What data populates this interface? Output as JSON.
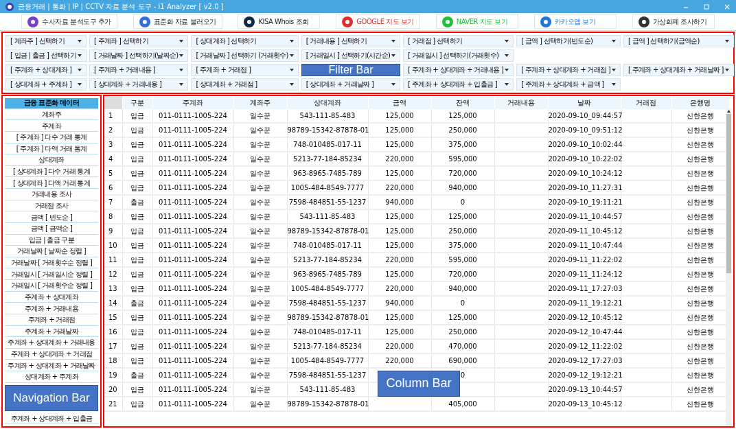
{
  "window": {
    "title": "금융거래 | 통화 | IP | CCTV 자료 분석 도구 - i1 Analyzer [ v2.0 ]"
  },
  "toolbar": [
    {
      "label": "수사자료 분석도구 추가",
      "color": "#7a3fc8"
    },
    {
      "label": "표준화 자료 불러오기",
      "color": "#2f6fe0"
    },
    {
      "label": "KISA Whois 조회",
      "color": "#0e2a4a"
    },
    {
      "label": "GOOGLE 지도 보기",
      "color": "#e0312f"
    },
    {
      "label": "NAVER 지도 보기",
      "color": "#1fbf3a"
    },
    {
      "label": "카카오맵 보기",
      "color": "#1f78d8"
    },
    {
      "label": "가상화폐 조사하기",
      "color": "#333333"
    }
  ],
  "filter_bar": {
    "annotation": "Filter Bar",
    "rows": [
      [
        "[ 계좌주 ] 선택하기",
        "[ 주계좌 ] 선택하기",
        "[ 상대계좌 ] 선택하기",
        "[ 거래내용 ] 선택하기",
        "[ 거래점 ] 선택하기",
        "[ 금액 ] 선택하기(빈도순)",
        "[ 금액 ] 선택하기(금액순)"
      ],
      [
        "[ 입금 | 출금 ] 선택하기",
        "[ 거래날짜 ] 선택하기(날짜순)",
        "[ 거래날짜 ] 선택하기 (거래횟수)",
        "[ 거래일시 ] 선택하기(시간순)",
        "[ 거래일시 ] 선택하기(거래횟수)"
      ],
      [
        "[ 주계좌 + 상대계좌 ]",
        "[ 주계좌 + 거래내용 ]",
        "[ 주계좌 + 거래점 ]",
        null,
        "[ 주계좌 + 상대계좌 + 거래내용 ]",
        "[ 주계좌 + 상대계좌 + 거래점 ]",
        "[ 주계좌 + 상대계좌 + 거래날짜 ]"
      ],
      [
        "[ 상대계좌 + 주계좌 ]",
        "[ 상대계좌 + 거래내용 ]",
        "[ 상대계좌 + 거래점 ]",
        "[ 상대계좌 + 거래날짜 ]",
        "[ 주계좌 + 상대계좌 + 입출금 ]",
        "[ 주계좌 + 상대계좌 + 금액 ]"
      ]
    ]
  },
  "navigation": {
    "annotation": "Navigation Bar",
    "items": [
      {
        "label": "금융 표준화 데이터",
        "selected": true
      },
      {
        "label": "계좌주",
        "selected": false
      },
      {
        "label": "주계좌",
        "selected": false
      },
      {
        "label": "[ 주계좌 ] 다수 거래 통계",
        "selected": false
      },
      {
        "label": "[ 주계좌 ] 다액 거래 통계",
        "selected": false
      },
      {
        "label": "상대계좌",
        "selected": false
      },
      {
        "label": "[ 상대계좌 ] 다수 거래 통계",
        "selected": false
      },
      {
        "label": "[ 상대계좌 ] 다액 거래 통계",
        "selected": false
      },
      {
        "label": "거래내용 조사",
        "selected": false
      },
      {
        "label": "거래점 조사",
        "selected": false
      },
      {
        "label": "금액 [ 빈도순 ]",
        "selected": false
      },
      {
        "label": "금액 [ 금액순 ]",
        "selected": false
      },
      {
        "label": "입금 | 출금 구분",
        "selected": false
      },
      {
        "label": "거래날짜 [ 날짜순 정렬 ]",
        "selected": false
      },
      {
        "label": "거래날짜 [ 거래횟수순 정렬 ]",
        "selected": false
      },
      {
        "label": "거래일시 [ 거래일시순 정렬 ]",
        "selected": false
      },
      {
        "label": "거래일시 [ 거래횟수순 정렬 ]",
        "selected": false
      },
      {
        "label": "주계좌 + 상대계좌",
        "selected": false
      },
      {
        "label": "주계좌 + 거래내용",
        "selected": false
      },
      {
        "label": "주계좌 + 거래점",
        "selected": false
      },
      {
        "label": "주계좌 + 거래날짜",
        "selected": false
      },
      {
        "label": "주계좌 + 상대계좌 + 거래내용",
        "selected": false
      },
      {
        "label": "주계좌 + 상대계좌 + 거래점",
        "selected": false
      },
      {
        "label": "주계좌 + 상대계좌 + 거래날짜",
        "selected": false
      },
      {
        "label": "상대계좌 + 주계좌",
        "selected": false
      },
      {
        "kind": "annotation"
      },
      {
        "label": "주계좌 + 상대계좌 + 입출금",
        "selected": false
      }
    ]
  },
  "table": {
    "annotation": "Column Bar",
    "columns": [
      "구분",
      "주계좌",
      "계좌주",
      "상대계좌",
      "금액",
      "잔액",
      "거래내용",
      "날짜",
      "거래점",
      "은행명"
    ],
    "rows": [
      {
        "no": "1",
        "type": "입금",
        "account": "011-0111-1005-224",
        "owner": "일수꾼",
        "counterpart": "543-111-85-483",
        "amount": "125,000",
        "balance": "125,000",
        "date": "2020-09-10_09:44:57",
        "bank": "신한은행"
      },
      {
        "no": "2",
        "type": "입금",
        "account": "011-0111-1005-224",
        "owner": "일수꾼",
        "counterpart": "98789-15342-87878-01",
        "amount": "125,000",
        "balance": "250,000",
        "date": "2020-09-10_09:51:12",
        "bank": "신한은행"
      },
      {
        "no": "3",
        "type": "입금",
        "account": "011-0111-1005-224",
        "owner": "일수꾼",
        "counterpart": "748-010485-017-11",
        "amount": "125,000",
        "balance": "375,000",
        "date": "2020-09-10_10:02:44",
        "bank": "신한은행"
      },
      {
        "no": "4",
        "type": "입금",
        "account": "011-0111-1005-224",
        "owner": "일수꾼",
        "counterpart": "5213-77-184-85234",
        "amount": "220,000",
        "balance": "595,000",
        "date": "2020-09-10_10:22:02",
        "bank": "신한은행"
      },
      {
        "no": "5",
        "type": "입금",
        "account": "011-0111-1005-224",
        "owner": "일수꾼",
        "counterpart": "963-8965-7485-789",
        "amount": "125,000",
        "balance": "720,000",
        "date": "2020-09-10_10:24:12",
        "bank": "신한은행"
      },
      {
        "no": "6",
        "type": "입금",
        "account": "011-0111-1005-224",
        "owner": "일수꾼",
        "counterpart": "1005-484-8549-7777",
        "amount": "220,000",
        "balance": "940,000",
        "date": "2020-09-10_11:27:31",
        "bank": "신한은행"
      },
      {
        "no": "7",
        "type": "출금",
        "account": "011-0111-1005-224",
        "owner": "일수꾼",
        "counterpart": "7598-484851-55-1237",
        "amount": "940,000",
        "balance": "0",
        "date": "2020-09-10_19:11:21",
        "bank": "신한은행"
      },
      {
        "no": "8",
        "type": "입금",
        "account": "011-0111-1005-224",
        "owner": "일수꾼",
        "counterpart": "543-111-85-483",
        "amount": "125,000",
        "balance": "125,000",
        "date": "2020-09-11_10:44:57",
        "bank": "신한은행"
      },
      {
        "no": "9",
        "type": "입금",
        "account": "011-0111-1005-224",
        "owner": "일수꾼",
        "counterpart": "98789-15342-87878-01",
        "amount": "125,000",
        "balance": "250,000",
        "date": "2020-09-11_10:45:12",
        "bank": "신한은행"
      },
      {
        "no": "10",
        "type": "입금",
        "account": "011-0111-1005-224",
        "owner": "일수꾼",
        "counterpart": "748-010485-017-11",
        "amount": "125,000",
        "balance": "375,000",
        "date": "2020-09-11_10:47:44",
        "bank": "신한은행"
      },
      {
        "no": "11",
        "type": "입금",
        "account": "011-0111-1005-224",
        "owner": "일수꾼",
        "counterpart": "5213-77-184-85234",
        "amount": "220,000",
        "balance": "595,000",
        "date": "2020-09-11_11:22:02",
        "bank": "신한은행"
      },
      {
        "no": "12",
        "type": "입금",
        "account": "011-0111-1005-224",
        "owner": "일수꾼",
        "counterpart": "963-8965-7485-789",
        "amount": "125,000",
        "balance": "720,000",
        "date": "2020-09-11_11:24:12",
        "bank": "신한은행"
      },
      {
        "no": "13",
        "type": "입금",
        "account": "011-0111-1005-224",
        "owner": "일수꾼",
        "counterpart": "1005-484-8549-7777",
        "amount": "220,000",
        "balance": "940,000",
        "date": "2020-09-11_17:27:03",
        "bank": "신한은행"
      },
      {
        "no": "14",
        "type": "출금",
        "account": "011-0111-1005-224",
        "owner": "일수꾼",
        "counterpart": "7598-484851-55-1237",
        "amount": "940,000",
        "balance": "0",
        "date": "2020-09-11_19:12:21",
        "bank": "신한은행"
      },
      {
        "no": "15",
        "type": "입금",
        "account": "011-0111-1005-224",
        "owner": "일수꾼",
        "counterpart": "98789-15342-87878-01",
        "amount": "125,000",
        "balance": "125,000",
        "date": "2020-09-12_10:45:12",
        "bank": "신한은행"
      },
      {
        "no": "16",
        "type": "입금",
        "account": "011-0111-1005-224",
        "owner": "일수꾼",
        "counterpart": "748-010485-017-11",
        "amount": "125,000",
        "balance": "250,000",
        "date": "2020-09-12_10:47:44",
        "bank": "신한은행"
      },
      {
        "no": "17",
        "type": "입금",
        "account": "011-0111-1005-224",
        "owner": "일수꾼",
        "counterpart": "5213-77-184-85234",
        "amount": "220,000",
        "balance": "470,000",
        "date": "2020-09-12_11:22:02",
        "bank": "신한은행"
      },
      {
        "no": "18",
        "type": "입금",
        "account": "011-0111-1005-224",
        "owner": "일수꾼",
        "counterpart": "1005-484-8549-7777",
        "amount": "220,000",
        "balance": "690,000",
        "date": "2020-09-12_17:27:03",
        "bank": "신한은행"
      },
      {
        "no": "19",
        "type": "출금",
        "account": "011-0111-1005-224",
        "owner": "일수꾼",
        "counterpart": "7598-484851-55-1237",
        "balance": "0",
        "date": "2020-09-12_19:12:21",
        "bank": "신한은행"
      },
      {
        "no": "20",
        "type": "입금",
        "account": "011-0111-1005-224",
        "owner": "일수꾼",
        "counterpart": "543-111-85-483",
        "date": "2020-09-13_10:44:57",
        "bank": "신한은행"
      },
      {
        "no": "21",
        "type": "입금",
        "account": "011-0111-1005-224",
        "owner": "일수꾼",
        "counterpart": "98789-15342-87878-01",
        "balance": "405,000",
        "date": "2020-09-13_10:45:12",
        "bank": "신한은행"
      }
    ]
  }
}
